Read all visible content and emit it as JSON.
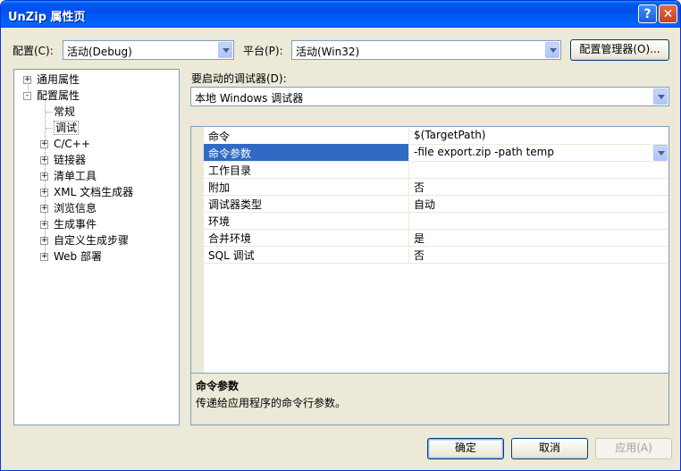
{
  "window": {
    "title": "UnZip 属性页"
  },
  "titlebar_buttons": {
    "help": "?",
    "close": "✕"
  },
  "config": {
    "label": "配置(C):",
    "value": "活动(Debug)"
  },
  "platform": {
    "label": "平台(P):",
    "value": "活动(Win32)"
  },
  "config_manager_button": "配置管理器(O)...",
  "tree": {
    "common_properties": "通用属性",
    "config_properties": "配置属性",
    "general": "常规",
    "debugging": "调试",
    "children": [
      "C/C++",
      "链接器",
      "清单工具",
      "XML 文档生成器",
      "浏览信息",
      "生成事件",
      "自定义生成步骤",
      "Web 部署"
    ],
    "expand_symbol": "+",
    "collapse_symbol": "-"
  },
  "debugger": {
    "label": "要启动的调试器(D):",
    "value": "本地 Windows 调试器"
  },
  "properties": [
    {
      "name": "命令",
      "value": "$(TargetPath)"
    },
    {
      "name": "命令参数",
      "value": "-file export.zip -path temp"
    },
    {
      "name": "工作目录",
      "value": ""
    },
    {
      "name": "附加",
      "value": "否"
    },
    {
      "name": "调试器类型",
      "value": "自动"
    },
    {
      "name": "环境",
      "value": ""
    },
    {
      "name": "合并环境",
      "value": "是"
    },
    {
      "name": "SQL 调试",
      "value": "否"
    }
  ],
  "selected_property_index": 1,
  "description": {
    "title": "命令参数",
    "text": "传递给应用程序的命令行参数。"
  },
  "buttons": {
    "ok": "确定",
    "cancel": "取消",
    "apply": "应用(A)"
  }
}
